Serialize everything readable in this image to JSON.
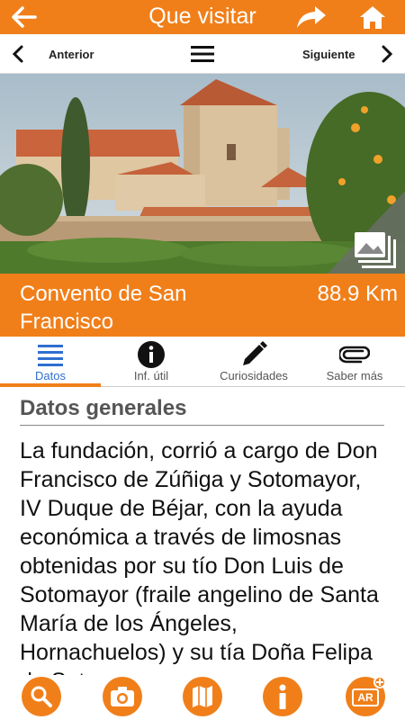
{
  "topbar": {
    "title": "Que visitar"
  },
  "navbar": {
    "prev_label": "Anterior",
    "next_label": "Siguiente"
  },
  "place": {
    "name": "Convento de San Francisco",
    "distance": "88.9 Km"
  },
  "tabs": [
    {
      "label": "Datos",
      "icon": "list-icon",
      "active": true
    },
    {
      "label": "Inf. útil",
      "icon": "info-icon",
      "active": false
    },
    {
      "label": "Curiosidades",
      "icon": "pencil-icon",
      "active": false
    },
    {
      "label": "Saber más",
      "icon": "paperclip-icon",
      "active": false
    }
  ],
  "content": {
    "section_title": "Datos generales",
    "body": "La fundación, corrió a cargo de Don Francisco de Zúñiga y Sotomayor, IV Duque de Béjar, con la ayuda económica a través de limosnas obtenidas por su tío Don Luis de Sotomayor (fraile angelino de Santa María de los Ángeles, Hornachuelos) y su tía Doña Felipa de Sotomayor"
  },
  "bottombar": {
    "ar_label": "AR"
  },
  "colors": {
    "accent": "#f07f1a",
    "active_tab": "#2f6fcf"
  }
}
